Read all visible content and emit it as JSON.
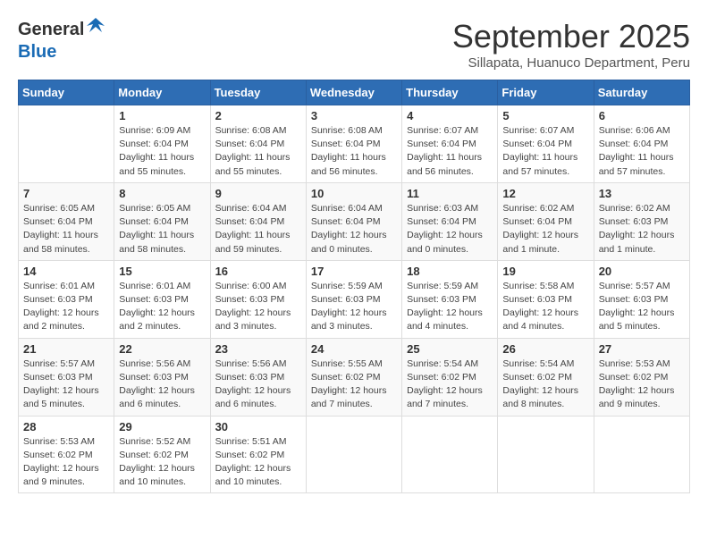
{
  "logo": {
    "general": "General",
    "blue": "Blue"
  },
  "title": "September 2025",
  "subtitle": "Sillapata, Huanuco Department, Peru",
  "headers": [
    "Sunday",
    "Monday",
    "Tuesday",
    "Wednesday",
    "Thursday",
    "Friday",
    "Saturday"
  ],
  "weeks": [
    [
      {
        "day": "",
        "info": ""
      },
      {
        "day": "1",
        "info": "Sunrise: 6:09 AM\nSunset: 6:04 PM\nDaylight: 11 hours\nand 55 minutes."
      },
      {
        "day": "2",
        "info": "Sunrise: 6:08 AM\nSunset: 6:04 PM\nDaylight: 11 hours\nand 55 minutes."
      },
      {
        "day": "3",
        "info": "Sunrise: 6:08 AM\nSunset: 6:04 PM\nDaylight: 11 hours\nand 56 minutes."
      },
      {
        "day": "4",
        "info": "Sunrise: 6:07 AM\nSunset: 6:04 PM\nDaylight: 11 hours\nand 56 minutes."
      },
      {
        "day": "5",
        "info": "Sunrise: 6:07 AM\nSunset: 6:04 PM\nDaylight: 11 hours\nand 57 minutes."
      },
      {
        "day": "6",
        "info": "Sunrise: 6:06 AM\nSunset: 6:04 PM\nDaylight: 11 hours\nand 57 minutes."
      }
    ],
    [
      {
        "day": "7",
        "info": "Sunrise: 6:05 AM\nSunset: 6:04 PM\nDaylight: 11 hours\nand 58 minutes."
      },
      {
        "day": "8",
        "info": "Sunrise: 6:05 AM\nSunset: 6:04 PM\nDaylight: 11 hours\nand 58 minutes."
      },
      {
        "day": "9",
        "info": "Sunrise: 6:04 AM\nSunset: 6:04 PM\nDaylight: 11 hours\nand 59 minutes."
      },
      {
        "day": "10",
        "info": "Sunrise: 6:04 AM\nSunset: 6:04 PM\nDaylight: 12 hours\nand 0 minutes."
      },
      {
        "day": "11",
        "info": "Sunrise: 6:03 AM\nSunset: 6:04 PM\nDaylight: 12 hours\nand 0 minutes."
      },
      {
        "day": "12",
        "info": "Sunrise: 6:02 AM\nSunset: 6:04 PM\nDaylight: 12 hours\nand 1 minute."
      },
      {
        "day": "13",
        "info": "Sunrise: 6:02 AM\nSunset: 6:03 PM\nDaylight: 12 hours\nand 1 minute."
      }
    ],
    [
      {
        "day": "14",
        "info": "Sunrise: 6:01 AM\nSunset: 6:03 PM\nDaylight: 12 hours\nand 2 minutes."
      },
      {
        "day": "15",
        "info": "Sunrise: 6:01 AM\nSunset: 6:03 PM\nDaylight: 12 hours\nand 2 minutes."
      },
      {
        "day": "16",
        "info": "Sunrise: 6:00 AM\nSunset: 6:03 PM\nDaylight: 12 hours\nand 3 minutes."
      },
      {
        "day": "17",
        "info": "Sunrise: 5:59 AM\nSunset: 6:03 PM\nDaylight: 12 hours\nand 3 minutes."
      },
      {
        "day": "18",
        "info": "Sunrise: 5:59 AM\nSunset: 6:03 PM\nDaylight: 12 hours\nand 4 minutes."
      },
      {
        "day": "19",
        "info": "Sunrise: 5:58 AM\nSunset: 6:03 PM\nDaylight: 12 hours\nand 4 minutes."
      },
      {
        "day": "20",
        "info": "Sunrise: 5:57 AM\nSunset: 6:03 PM\nDaylight: 12 hours\nand 5 minutes."
      }
    ],
    [
      {
        "day": "21",
        "info": "Sunrise: 5:57 AM\nSunset: 6:03 PM\nDaylight: 12 hours\nand 5 minutes."
      },
      {
        "day": "22",
        "info": "Sunrise: 5:56 AM\nSunset: 6:03 PM\nDaylight: 12 hours\nand 6 minutes."
      },
      {
        "day": "23",
        "info": "Sunrise: 5:56 AM\nSunset: 6:03 PM\nDaylight: 12 hours\nand 6 minutes."
      },
      {
        "day": "24",
        "info": "Sunrise: 5:55 AM\nSunset: 6:02 PM\nDaylight: 12 hours\nand 7 minutes."
      },
      {
        "day": "25",
        "info": "Sunrise: 5:54 AM\nSunset: 6:02 PM\nDaylight: 12 hours\nand 7 minutes."
      },
      {
        "day": "26",
        "info": "Sunrise: 5:54 AM\nSunset: 6:02 PM\nDaylight: 12 hours\nand 8 minutes."
      },
      {
        "day": "27",
        "info": "Sunrise: 5:53 AM\nSunset: 6:02 PM\nDaylight: 12 hours\nand 9 minutes."
      }
    ],
    [
      {
        "day": "28",
        "info": "Sunrise: 5:53 AM\nSunset: 6:02 PM\nDaylight: 12 hours\nand 9 minutes."
      },
      {
        "day": "29",
        "info": "Sunrise: 5:52 AM\nSunset: 6:02 PM\nDaylight: 12 hours\nand 10 minutes."
      },
      {
        "day": "30",
        "info": "Sunrise: 5:51 AM\nSunset: 6:02 PM\nDaylight: 12 hours\nand 10 minutes."
      },
      {
        "day": "",
        "info": ""
      },
      {
        "day": "",
        "info": ""
      },
      {
        "day": "",
        "info": ""
      },
      {
        "day": "",
        "info": ""
      }
    ]
  ]
}
